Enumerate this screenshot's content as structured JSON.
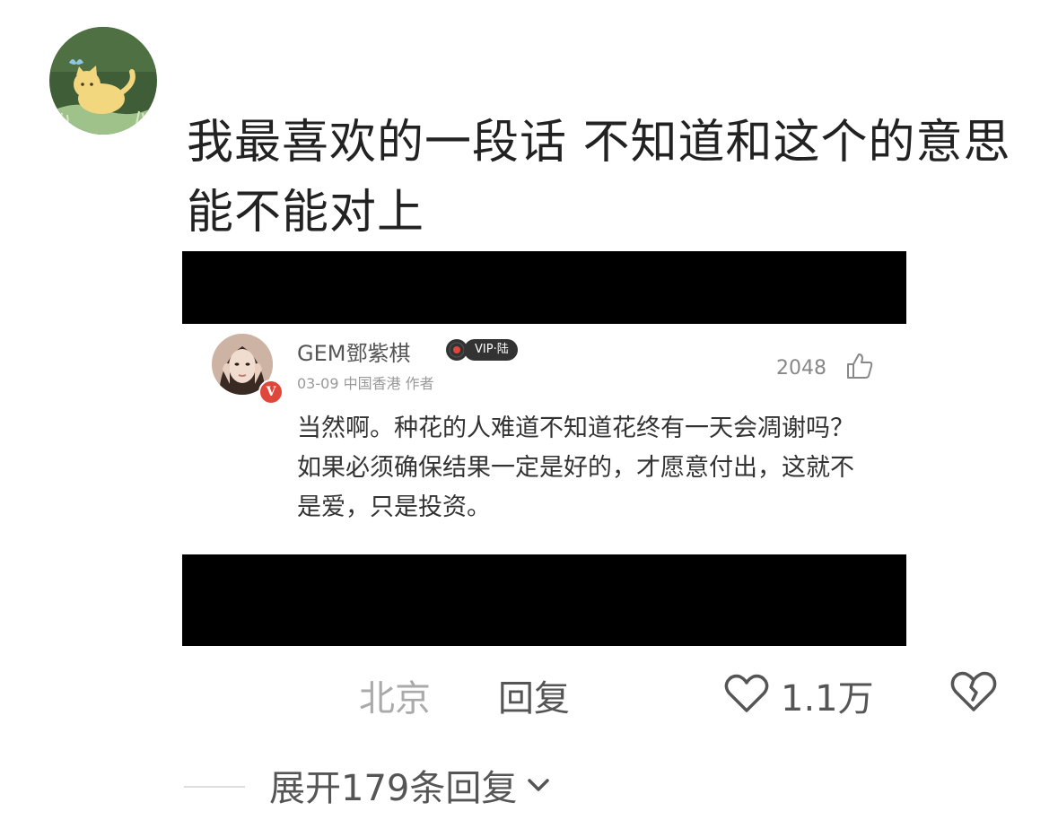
{
  "comment": {
    "text": "我最喜欢的一段话 不知道和这个的意思能不能对上",
    "location": "北京",
    "reply_label": "回复",
    "like_count": "1.1万",
    "expand_label": "展开179条回复"
  },
  "quoted": {
    "author": "GEM鄧紫棋",
    "vip_badge": "VIP·陆",
    "verified_badge": "V",
    "meta": "03-09 中国香港  作者",
    "likes": "2048",
    "body": "当然啊。种花的人难道不知道花终有一天会凋谢吗？如果必须确保结果一定是好的，才愿意付出，这就不是爱，只是投资。"
  },
  "icons": {
    "avatar": "cat-butterfly-avatar",
    "like": "heart-icon",
    "dislike": "broken-heart-icon",
    "thumb": "thumbs-up-icon",
    "expand": "chevron-down-icon"
  }
}
